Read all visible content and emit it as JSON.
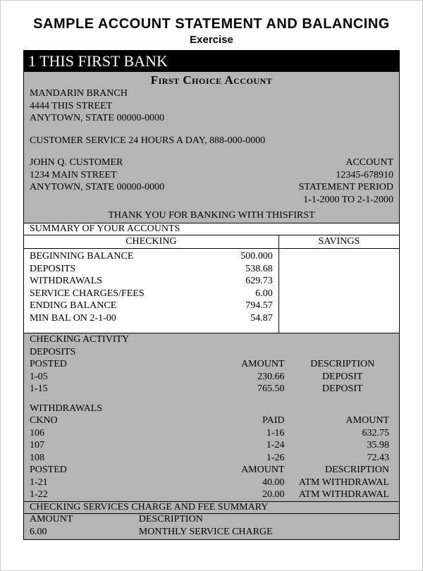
{
  "title": "SAMPLE ACCOUNT STATEMENT AND BALANCING",
  "subtitle": "Exercise",
  "bank_name": "1 THIS FIRST BANK",
  "account_type": "First Choice Account",
  "branch": {
    "name": "MANDARIN BRANCH",
    "street": "4444 THIS STREET",
    "city_state_zip": "ANYTOWN, STATE 00000-0000"
  },
  "customer_service": "CUSTOMER SERVICE 24 HOURS A DAY, 888-000-0000",
  "customer": {
    "name": "JOHN Q. CUSTOMER",
    "street": "1234 MAIN STREET",
    "city_state_zip": "ANYTOWN, STATE 00000-0000"
  },
  "account_label": "ACCOUNT",
  "account_number": "12345-678910",
  "period_label": "STATEMENT PERIOD",
  "period_value": "1-1-2000 TO 2-1-2000",
  "thanks": "THANK YOU FOR BANKING WITH THISFIRST",
  "summary_title": "SUMMARY OF YOUR ACCOUNTS",
  "col_checking": "CHECKING",
  "col_savings": "SAVINGS",
  "checking_summary": [
    {
      "label": "BEGINNING BALANCE",
      "value": "500.000"
    },
    {
      "label": "DEPOSITS",
      "value": "538.68"
    },
    {
      "label": "WITHDRAWALS",
      "value": "629.73"
    },
    {
      "label": "SERVICE CHARGES/FEES",
      "value": "6.00"
    },
    {
      "label": "ENDING BALANCE",
      "value": "794.57"
    },
    {
      "label": "MIN BAL ON 2-1-00",
      "value": "54.87"
    }
  ],
  "activity_title": "CHECKING ACTIVITY",
  "deposits_title": "DEPOSITS",
  "deposits_headers": {
    "c1": "POSTED",
    "c2": "AMOUNT",
    "c3": "DESCRIPTION"
  },
  "deposits": [
    {
      "posted": "1-05",
      "amount": "230.66",
      "desc": "DEPOSIT"
    },
    {
      "posted": "1-15",
      "amount": "765.50",
      "desc": "DEPOSIT"
    }
  ],
  "withdrawals_title": "WITHDRAWALS",
  "withdrawals_headers": {
    "c1": "CKNO",
    "c2": "PAID",
    "c3": "AMOUNT"
  },
  "withdrawals_checks": [
    {
      "ckno": "106",
      "paid": "1-16",
      "amount": "632.75"
    },
    {
      "ckno": "107",
      "paid": "1-24",
      "amount": "35.98"
    },
    {
      "ckno": "108",
      "paid": "1-26",
      "amount": "72.43"
    }
  ],
  "withdrawals_other_headers": {
    "c1": "POSTED",
    "c2": "AMOUNT",
    "c3": "DESCRIPTION"
  },
  "withdrawals_other": [
    {
      "posted": "1-21",
      "amount": "40.00",
      "desc": "ATM WITHDRAWAL"
    },
    {
      "posted": "1-22",
      "amount": "20.00",
      "desc": "ATM WITHDRAWAL"
    }
  ],
  "fees_title": "CHECKING SERVICES CHARGE AND FEE SUMMARY",
  "fees_headers": {
    "amount": "AMOUNT",
    "desc": "DESCRIPTION"
  },
  "fees": [
    {
      "amount": "6.00",
      "desc": "MONTHLY SERVICE CHARGE"
    }
  ]
}
